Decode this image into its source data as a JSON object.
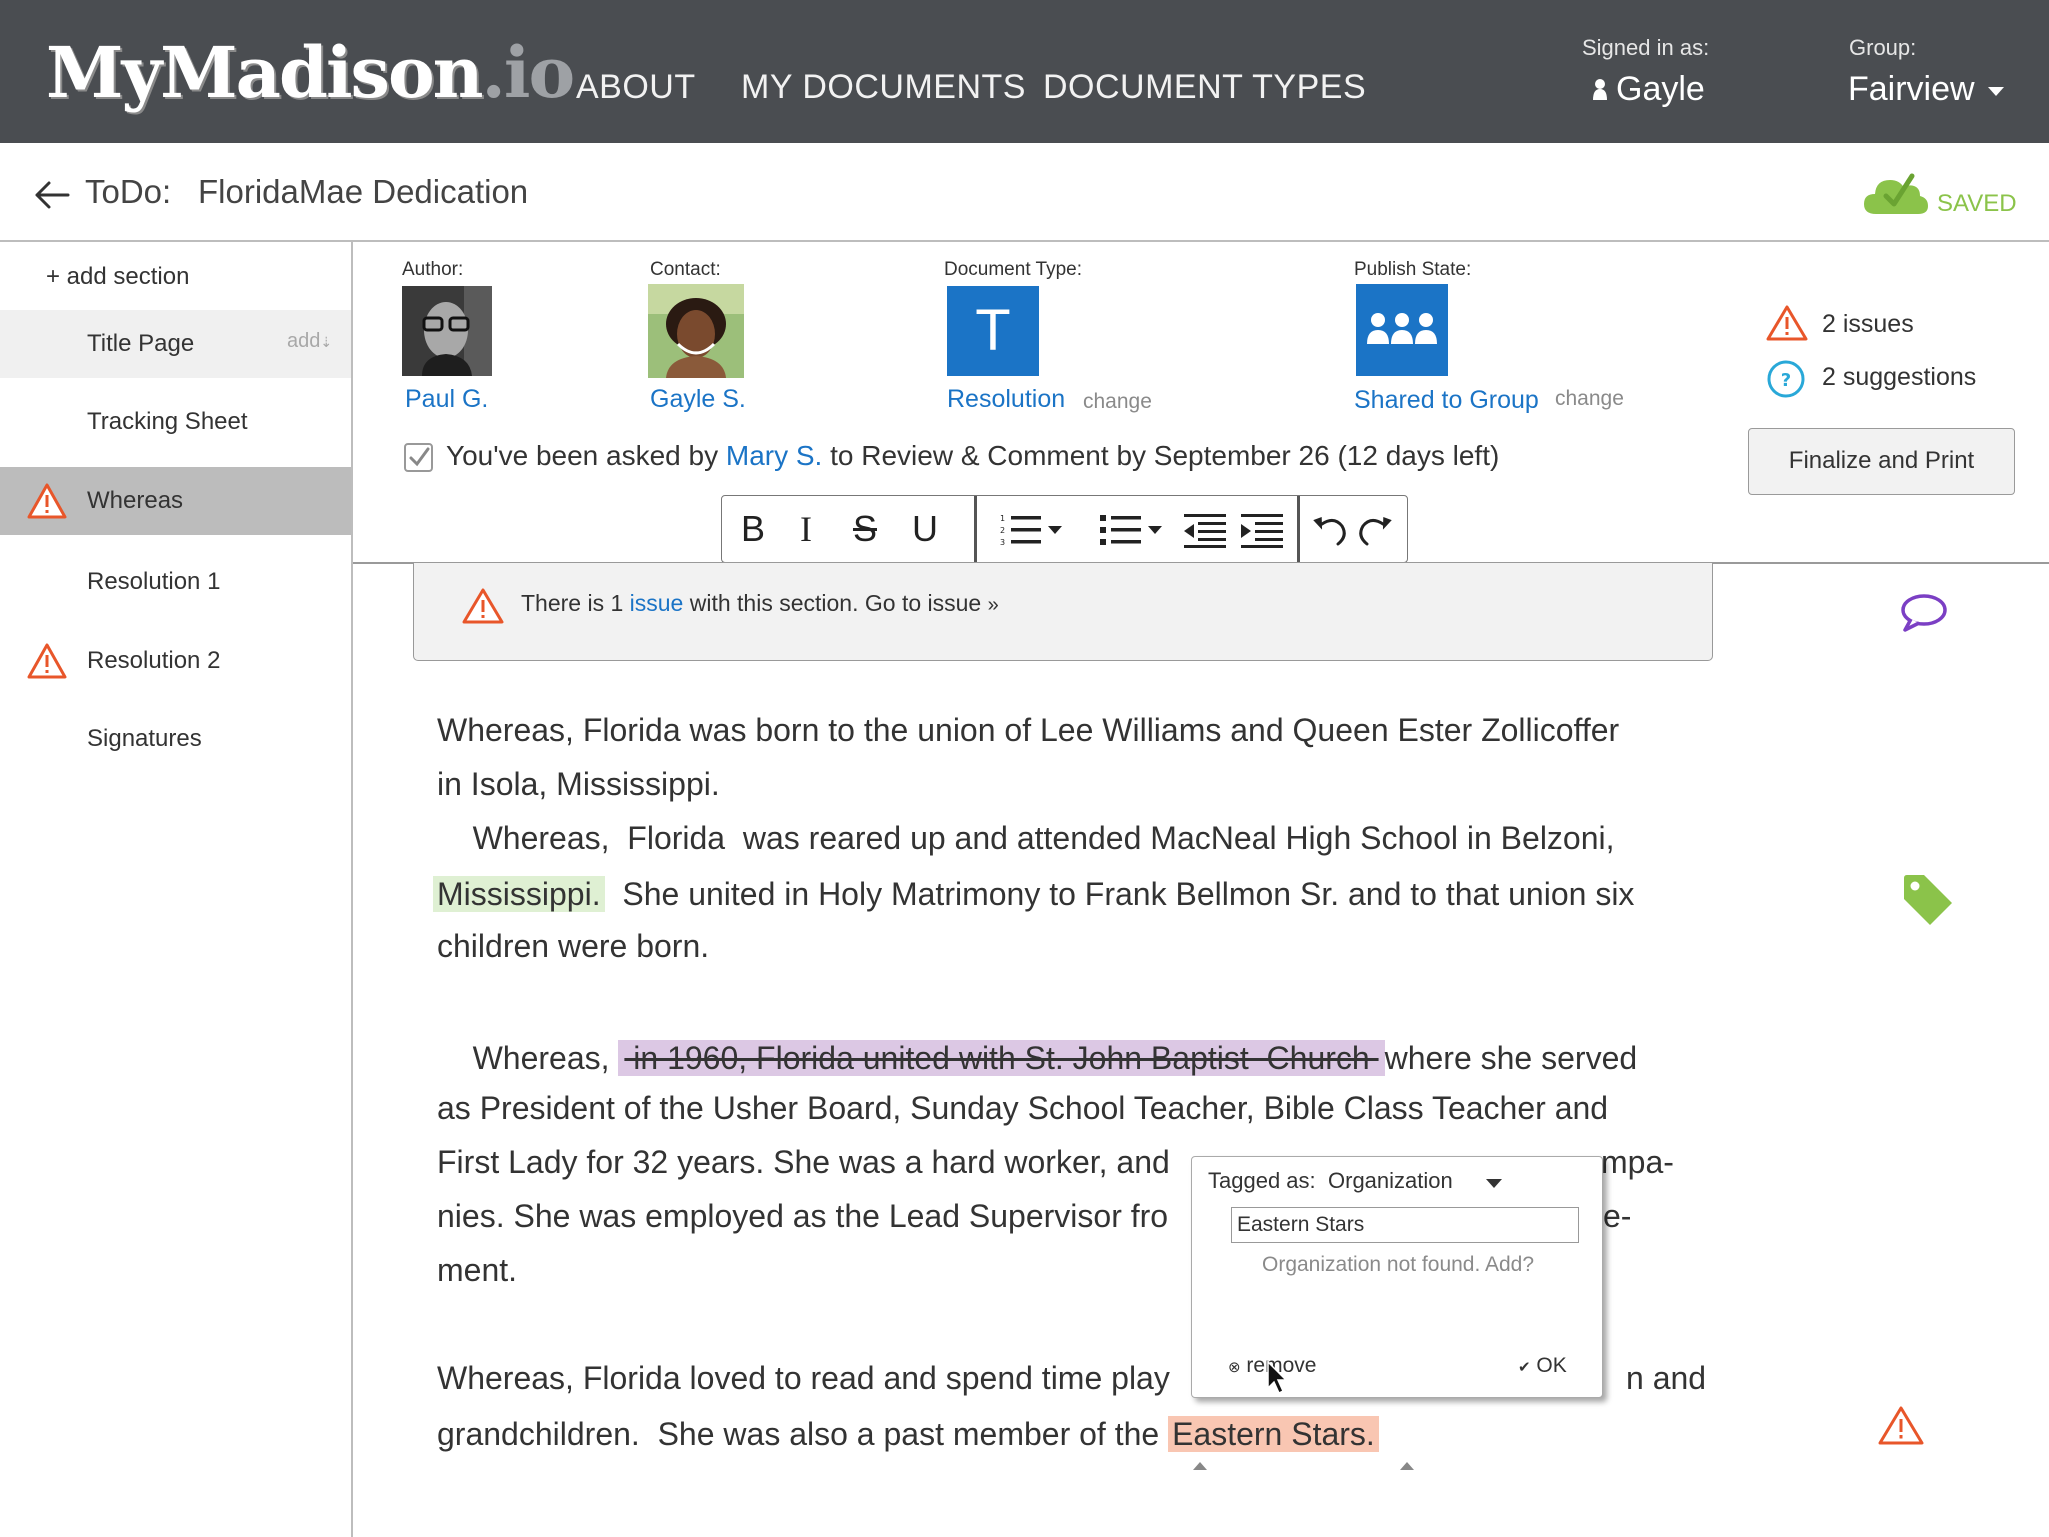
{
  "header": {
    "logo": "MyMadison",
    "logo_suffix": ".io",
    "nav": [
      "ABOUT",
      "MY DOCUMENTS",
      "DOCUMENT TYPES"
    ],
    "signed_in_label": "Signed in as:",
    "user_name": "Gayle",
    "group_label": "Group:",
    "group_name": "Fairview"
  },
  "titlebar": {
    "todo_label": "ToDo:",
    "doc_title": "FloridaMae Dedication",
    "saved": "SAVED"
  },
  "sidebar": {
    "add_section": "+ add section",
    "items": [
      {
        "label": "Title Page",
        "extra": "add"
      },
      {
        "label": "Tracking Sheet"
      },
      {
        "label": "Whereas",
        "warning": true,
        "selected": true
      },
      {
        "label": "Resolution 1"
      },
      {
        "label": "Resolution 2",
        "warning": true
      },
      {
        "label": "Signatures"
      }
    ]
  },
  "meta": {
    "author_label": "Author:",
    "author_name": "Paul G.",
    "contact_label": "Contact:",
    "contact_name": "Gayle S.",
    "doctype_label": "Document Type:",
    "doctype_letter": "T",
    "doctype_name": "Resolution",
    "publish_label": "Publish State:",
    "publish_name": "Shared to Group",
    "change": "change"
  },
  "issues": {
    "issues": "2 issues",
    "suggestions": "2 suggestions",
    "finalize": "Finalize and Print"
  },
  "review": {
    "prefix": "You've been asked by ",
    "person": "Mary S.",
    "suffix": " to Review & Comment by September 26 (12 days left)"
  },
  "toolbar": {
    "bold": "B",
    "italic": "I",
    "strike": "S",
    "underline": "U"
  },
  "banner": {
    "prefix": "There is 1 ",
    "issue_word": "issue",
    "middle": " with this section.  ",
    "goto": "Go to issue"
  },
  "document": {
    "p1_l1": "Whereas,  Florida was born to the union of Lee Williams and Queen Ester Zollicoffer",
    "p1_l2": "in Isola, Mississippi.",
    "p2_l1": "    Whereas,  Florida  was reared up and attended MacNeal High School in Belzoni,",
    "p2_l2_hl": "Mississippi.",
    "p2_l2_rest": "  She united in Holy Matrimony to Frank Bellmon Sr. and to that union six",
    "p2_l3": "children were born.",
    "p3_l1_pre": "    Whereas, ",
    "p3_l1_strike": " in 1960, Florida united with St. John Baptist  Church ",
    "p3_l1_post": "where she served",
    "p3_l2": "as President of the Usher Board, Sunday School Teacher, Bible Class Teacher and",
    "p3_l3_a": "First Lady for 32 years.  She was a hard worker, and",
    "p3_l3_b": "mpa-",
    "p3_l4_a": "nies.  She was employed as the Lead Supervisor fro",
    "p3_l4_b": "e-",
    "p3_l5": "ment.",
    "p4_l1_a": "Whereas, Florida loved to read and spend time play",
    "p4_l1_b": "n and",
    "p4_l2_pre": "grandchildren.  She was also a past member of the ",
    "p4_l2_hl": "Eastern Stars."
  },
  "popup": {
    "tagged_label": "Tagged as:",
    "tag_type": "Organization",
    "input_value": "Eastern Stars",
    "message": "Organization not found. Add?",
    "remove": "remove",
    "ok": "OK"
  },
  "colors": {
    "topbar": "#4a4d51",
    "link": "#1b74c6",
    "warning": "#e8562a",
    "saved": "#8bc34a",
    "comment": "#7b3fc4",
    "tag": "#8bc34a",
    "suggestion": "#29a8d8"
  }
}
